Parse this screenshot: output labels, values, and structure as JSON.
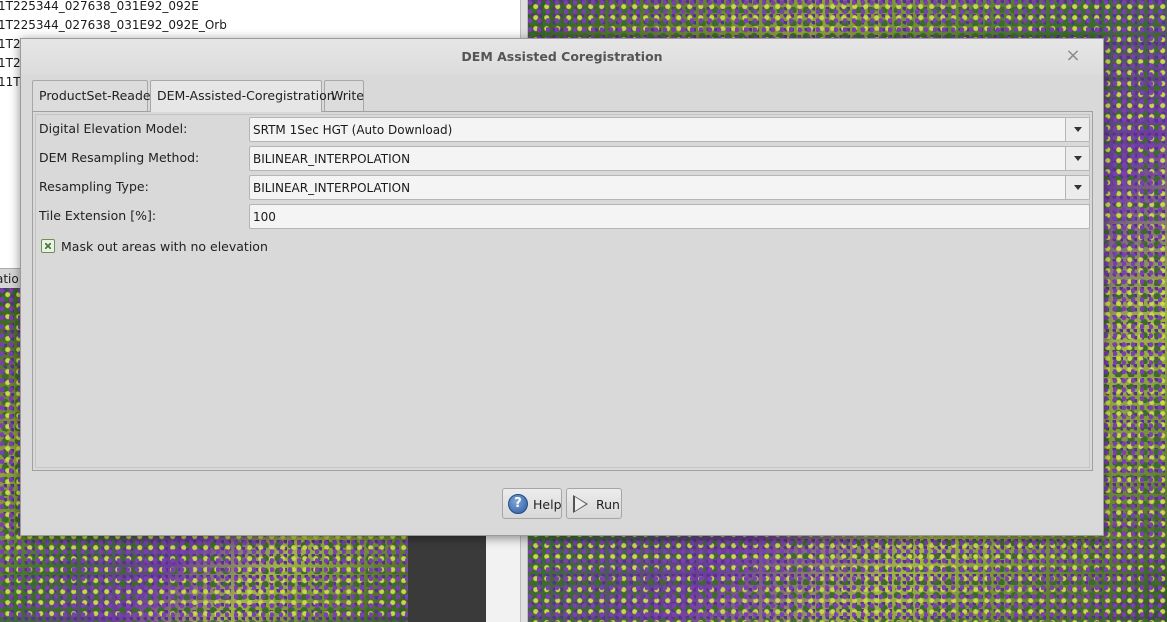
{
  "background": {
    "product_list": [
      "1T225344_027638_031E92_092E",
      "1T225344_027638_031E92_092E_Orb",
      "1T2",
      "1T2",
      "11T"
    ],
    "lower_panel_tab": "atio"
  },
  "dialog": {
    "title": "DEM Assisted Coregistration",
    "close_glyph": "×",
    "tabs": [
      {
        "label": "ProductSet-Reader",
        "active": false
      },
      {
        "label": "DEM-Assisted-Coregistration",
        "active": true
      },
      {
        "label": "Write",
        "active": false
      }
    ],
    "fields": {
      "dem": {
        "label": "Digital Elevation Model:",
        "value": "SRTM 1Sec HGT (Auto Download)"
      },
      "dem_resampling": {
        "label": "DEM Resampling Method:",
        "value": "BILINEAR_INTERPOLATION"
      },
      "resampling_type": {
        "label": "Resampling Type:",
        "value": "BILINEAR_INTERPOLATION"
      },
      "tile_extension": {
        "label": "Tile Extension [%]:",
        "value": "100"
      }
    },
    "mask_checkbox": {
      "label": "Mask out areas with no elevation",
      "checked": true
    },
    "buttons": {
      "help": {
        "label": "Help",
        "icon": "help-icon"
      },
      "run": {
        "label": "Run",
        "icon": "play-icon"
      }
    }
  }
}
